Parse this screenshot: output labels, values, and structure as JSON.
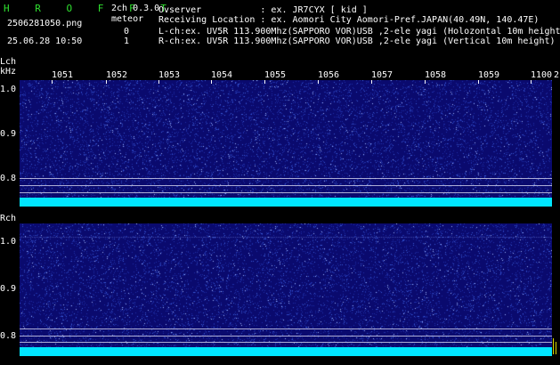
{
  "header": {
    "app_title": "H R O F F T",
    "mode": "2ch 0.3.0",
    "file_name": "2506281050.png",
    "datetime": "25.06.28 10:50",
    "meteor_label": "meteor",
    "meteor_lch": "0",
    "meteor_rch": "1",
    "observer_line": "Ovserver           : ex. JR7CYX [ kid ]",
    "location_line": "Receiving Location : ex. Aomori City Aomori-Pref.JAPAN(40.49N, 140.47E)",
    "lch_line": "L-ch:ex. UV5R 113.900Mhz(SAPPORO VOR)USB ,2-ele yagi (Holozontal 10m height)",
    "rch_line": "R-ch:ex. UV5R 113.900Mhz(SAPPORO VOR)USB ,2-ele yagi (Vertical 10m height)"
  },
  "lch_panel": {
    "channel_label": "Lch",
    "unit_label": "kHz",
    "y_ticks": [
      "1.0",
      "0.9",
      "0.8"
    ],
    "time_ticks": [
      "1051",
      "1052",
      "1053",
      "1054",
      "1055",
      "1056",
      "1057",
      "1058",
      "1059",
      "1100",
      "2"
    ]
  },
  "rch_panel": {
    "channel_label": "Rch",
    "y_ticks": [
      "1.0",
      "0.9",
      "0.8"
    ]
  },
  "colors": {
    "background": "#000000",
    "spectrogram": "#0a0a6e",
    "noise_floor": "#00e5ff",
    "header_green": "#2fe02f",
    "text_white": "#ffffff"
  }
}
